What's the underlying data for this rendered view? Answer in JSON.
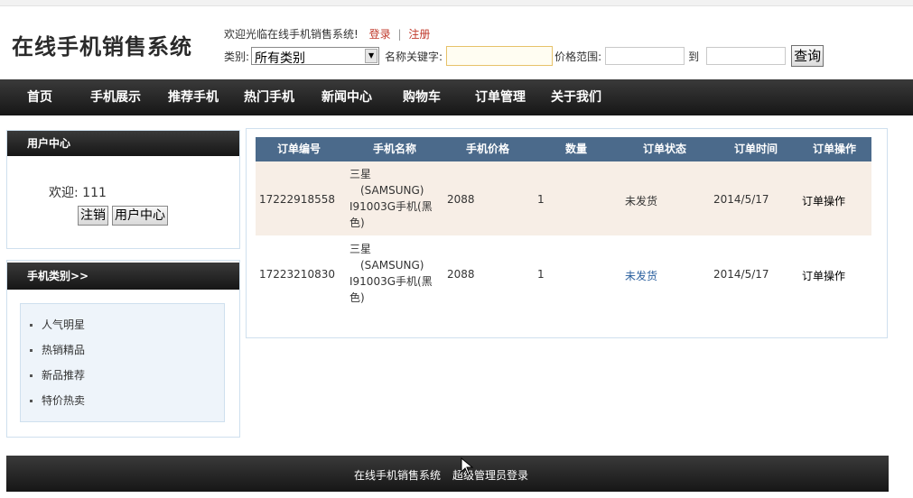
{
  "header": {
    "logo": "在线手机销售系统",
    "welcome_text": "欢迎光临在线手机销售系统!",
    "login": "登录",
    "divider": "|",
    "register": "注册"
  },
  "search": {
    "category_label": "类别:",
    "category_value": "所有类别",
    "keyword_label": "名称关键字:",
    "keyword_value": "",
    "price_label": "价格范围:",
    "price_from": "",
    "to_label": "到",
    "price_to": "",
    "query_button": "查询"
  },
  "nav": {
    "items": [
      "首页",
      "手机展示",
      "推荐手机",
      "热门手机",
      "新闻中心",
      "购物车",
      "订单管理",
      "关于我们"
    ]
  },
  "user_center": {
    "title": "用户中心",
    "welcome": "欢迎: 111",
    "logout_button": "注销",
    "center_button": "用户中心"
  },
  "categories": {
    "title": "手机类别>>",
    "items": [
      "人气明星",
      "热销精品",
      "新品推荐",
      "特价热卖"
    ]
  },
  "orders": {
    "headers": [
      "订单编号",
      "手机名称",
      "手机价格",
      "数量",
      "订单状态",
      "订单时间",
      "订单操作"
    ],
    "rows": [
      {
        "order_no": "17222918558",
        "name_lines": [
          "三星",
          "(SAMSUNG)",
          "I91003G手机(黑",
          "色)"
        ],
        "price": "2088",
        "quantity": "1",
        "status": "未发货",
        "time": "2014/5/17",
        "action": "订单操作"
      },
      {
        "order_no": "17223210830",
        "name_lines": [
          "三星",
          "(SAMSUNG)",
          "I91003G手机(黑",
          "色)"
        ],
        "price": "2088",
        "quantity": "1",
        "status": "未发货",
        "time": "2014/5/17",
        "action": "订单操作"
      }
    ]
  },
  "footer": {
    "site_name": "在线手机销售系统",
    "admin_login": "超级管理员登录"
  },
  "colors": {
    "nav_bg": "#1c1c1c",
    "table_header": "#4b6a8b",
    "row_highlight": "#f7eee6",
    "link_red": "#c0392b",
    "status_blue": "#2a5f9e"
  }
}
